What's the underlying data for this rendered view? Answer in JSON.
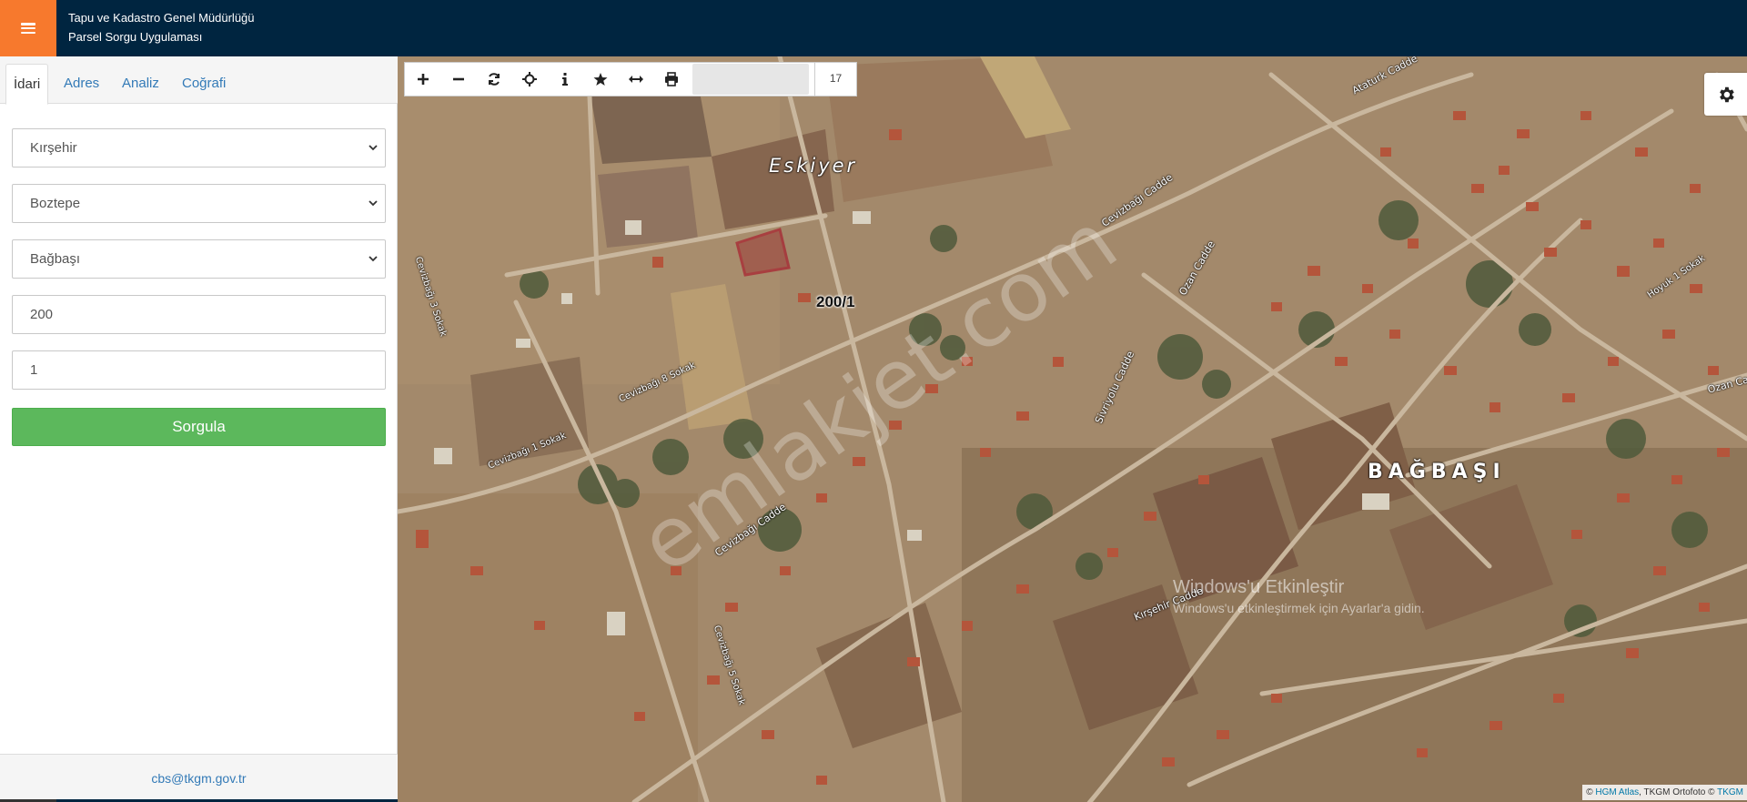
{
  "header": {
    "org_name": "Tapu ve Kadastro Genel Müdürlüğü",
    "app_name": "Parsel Sorgu Uygulaması"
  },
  "sidebar": {
    "tabs": [
      {
        "label": "İdari",
        "active": true
      },
      {
        "label": "Adres",
        "active": false
      },
      {
        "label": "Analiz",
        "active": false
      },
      {
        "label": "Coğrafi",
        "active": false
      }
    ],
    "form": {
      "il": "Kırşehir",
      "ilce": "Boztepe",
      "mahalle": "Bağbaşı",
      "ada": "200",
      "parsel": "1",
      "submit_label": "Sorgula"
    },
    "footer_email": "cbs@tkgm.gov.tr"
  },
  "map": {
    "zoom_level": "17",
    "parcel_label": "200/1",
    "watermark": "emlakjet.com",
    "place_labels": [
      "Eskiyer",
      "BAĞBAŞI"
    ],
    "street_labels": {
      "s1": "Cevizbağı 3 Sokak",
      "s2": "Cevizbağı Cadde",
      "s3": "Cevizbağı 1 Sokak",
      "s4": "Cevizbağı 8 Sokak",
      "s5": "Sivriyolu Cadde",
      "s6": "Ozan Cadde",
      "s7": "Kırşehir Cadde",
      "s8": "Ataturk Cadde",
      "s9": "Hoyuk 1 Sokak",
      "s10": "Ozan Cadde",
      "s11": "Cevizbağı Cadde",
      "s12": "Cevizbağı 5 Sokak"
    },
    "windows_notice": {
      "line1": "Windows'u Etkinleştir",
      "line2": "Windows'u etkinleştirmek için Ayarlar'a gidin."
    },
    "attribution": {
      "prefix": "©",
      "hgm": "HGM Atlas",
      "middle": ", TKGM Ortofoto ©",
      "tkgm": "TKGM"
    }
  },
  "colors": {
    "header_bg": "#002540",
    "menu_accent": "#f7792d",
    "submit_green": "#5cb85c",
    "link_blue": "#337ab7",
    "parcel_outline": "#a8001c"
  },
  "icons": [
    "menu-icon",
    "zoom-in-icon",
    "zoom-out-icon",
    "refresh-icon",
    "locate-icon",
    "info-icon",
    "star-icon",
    "measure-icon",
    "print-icon",
    "gear-icon",
    "chevron-down-icon"
  ]
}
